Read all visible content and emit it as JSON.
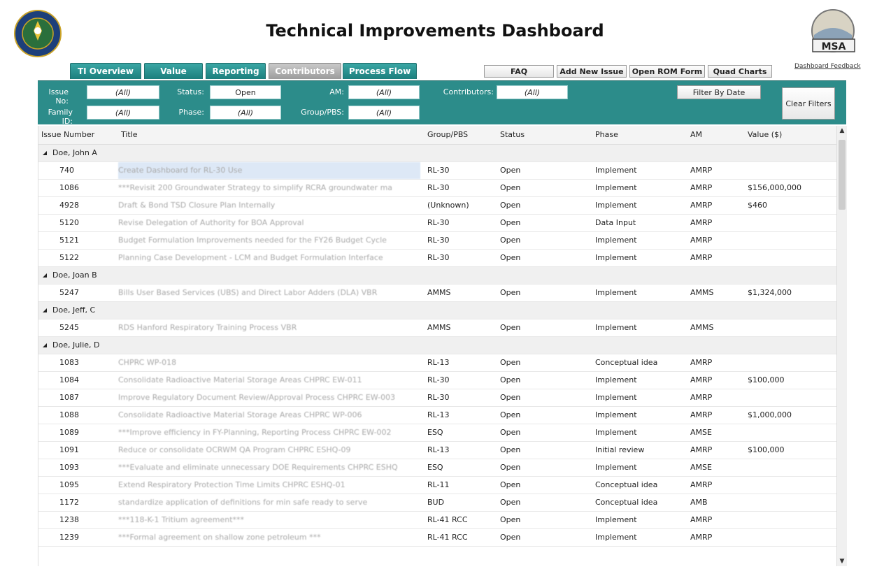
{
  "header": {
    "title": "Technical Improvements Dashboard",
    "msa_logo_text": "MSA",
    "feedback_link": "Dashboard Feedback"
  },
  "tabs": [
    {
      "label": "TI Overview",
      "active": false
    },
    {
      "label": "Value",
      "active": false
    },
    {
      "label": "Reporting",
      "active": false
    },
    {
      "label": "Contributors",
      "active": true
    },
    {
      "label": "Process Flow",
      "active": false
    }
  ],
  "top_buttons": [
    "FAQ",
    "Add New Issue",
    "Open ROM Form",
    "Quad Charts"
  ],
  "filters": {
    "issue_no_label": "Issue No:",
    "issue_no_value": "(All)",
    "status_label": "Status:",
    "status_value": "Open",
    "am_label": "AM:",
    "am_value": "(All)",
    "contributors_label": "Contributors:",
    "contributors_value": "(All)",
    "family_id_label": "Family ID:",
    "family_id_value": "(All)",
    "phase_label": "Phase:",
    "phase_value": "(All)",
    "group_label": "Group/PBS:",
    "group_value": "(All)",
    "filter_by_date": "Filter By Date",
    "clear_filters": "Clear Filters"
  },
  "columns": [
    "Issue Number",
    "Title",
    "Group/PBS",
    "Status",
    "Phase",
    "AM",
    "Value ($)"
  ],
  "rows": [
    {
      "group": "Doe, John A"
    },
    {
      "id": "740",
      "title": "Create Dashboard for RL-30 Use",
      "pbs": "RL-30",
      "status": "Open",
      "phase": "Implement",
      "am": "AMRP",
      "value": "",
      "selected": true
    },
    {
      "id": "1086",
      "title": "***Revisit 200 Groundwater Strategy to simplify RCRA groundwater ma",
      "pbs": "RL-30",
      "status": "Open",
      "phase": "Implement",
      "am": "AMRP",
      "value": "$156,000,000"
    },
    {
      "id": "4928",
      "title": "Draft & Bond TSD Closure Plan Internally",
      "pbs": "(Unknown)",
      "status": "Open",
      "phase": "Implement",
      "am": "AMRP",
      "value": "$460"
    },
    {
      "id": "5120",
      "title": "Revise Delegation of Authority for BOA Approval",
      "pbs": "RL-30",
      "status": "Open",
      "phase": "Data Input",
      "am": "AMRP",
      "value": ""
    },
    {
      "id": "5121",
      "title": "Budget Formulation Improvements needed for the FY26 Budget Cycle",
      "pbs": "RL-30",
      "status": "Open",
      "phase": "Implement",
      "am": "AMRP",
      "value": ""
    },
    {
      "id": "5122",
      "title": "Planning Case Development - LCM and Budget Formulation Interface",
      "pbs": "RL-30",
      "status": "Open",
      "phase": "Implement",
      "am": "AMRP",
      "value": ""
    },
    {
      "group": "Doe, Joan B"
    },
    {
      "id": "5247",
      "title": "Bills User Based Services (UBS) and Direct Labor Adders (DLA) VBR",
      "pbs": "AMMS",
      "status": "Open",
      "phase": "Implement",
      "am": "AMMS",
      "value": "$1,324,000"
    },
    {
      "group": "Doe, Jeff, C"
    },
    {
      "id": "5245",
      "title": "RDS Hanford Respiratory Training Process VBR",
      "pbs": "AMMS",
      "status": "Open",
      "phase": "Implement",
      "am": "AMMS",
      "value": ""
    },
    {
      "group": "Doe, Julie, D"
    },
    {
      "id": "1083",
      "title": "CHPRC WP-018",
      "pbs": "RL-13",
      "status": "Open",
      "phase": "Conceptual idea",
      "am": "AMRP",
      "value": ""
    },
    {
      "id": "1084",
      "title": "Consolidate Radioactive Material Storage Areas CHPRC EW-011",
      "pbs": "RL-30",
      "status": "Open",
      "phase": "Implement",
      "am": "AMRP",
      "value": "$100,000"
    },
    {
      "id": "1087",
      "title": "Improve Regulatory Document Review/Approval Process CHPRC EW-003",
      "pbs": "RL-30",
      "status": "Open",
      "phase": "Implement",
      "am": "AMRP",
      "value": ""
    },
    {
      "id": "1088",
      "title": "Consolidate Radioactive Material Storage Areas CHPRC WP-006",
      "pbs": "RL-13",
      "status": "Open",
      "phase": "Implement",
      "am": "AMRP",
      "value": "$1,000,000"
    },
    {
      "id": "1089",
      "title": "***Improve efficiency in FY-Planning, Reporting Process CHPRC EW-002",
      "pbs": "ESQ",
      "status": "Open",
      "phase": "Implement",
      "am": "AMSE",
      "value": ""
    },
    {
      "id": "1091",
      "title": "Reduce or consolidate OCRWM QA Program CHPRC ESHQ-09",
      "pbs": "RL-13",
      "status": "Open",
      "phase": "Initial review",
      "am": "AMRP",
      "value": "$100,000"
    },
    {
      "id": "1093",
      "title": "***Evaluate and eliminate unnecessary DOE Requirements CHPRC ESHQ",
      "pbs": "ESQ",
      "status": "Open",
      "phase": "Implement",
      "am": "AMSE",
      "value": ""
    },
    {
      "id": "1095",
      "title": "Extend Respiratory Protection Time Limits CHPRC ESHQ-01",
      "pbs": "RL-11",
      "status": "Open",
      "phase": "Conceptual idea",
      "am": "AMRP",
      "value": ""
    },
    {
      "id": "1172",
      "title": "standardize application of definitions for min safe ready to serve",
      "pbs": "BUD",
      "status": "Open",
      "phase": "Conceptual idea",
      "am": "AMB",
      "value": ""
    },
    {
      "id": "1238",
      "title": "***118-K-1 Tritium agreement***",
      "pbs": "RL-41 RCC",
      "status": "Open",
      "phase": "Implement",
      "am": "AMRP",
      "value": ""
    },
    {
      "id": "1239",
      "title": "***Formal agreement on shallow zone petroleum ***",
      "pbs": "RL-41 RCC",
      "status": "Open",
      "phase": "Implement",
      "am": "AMRP",
      "value": ""
    }
  ]
}
